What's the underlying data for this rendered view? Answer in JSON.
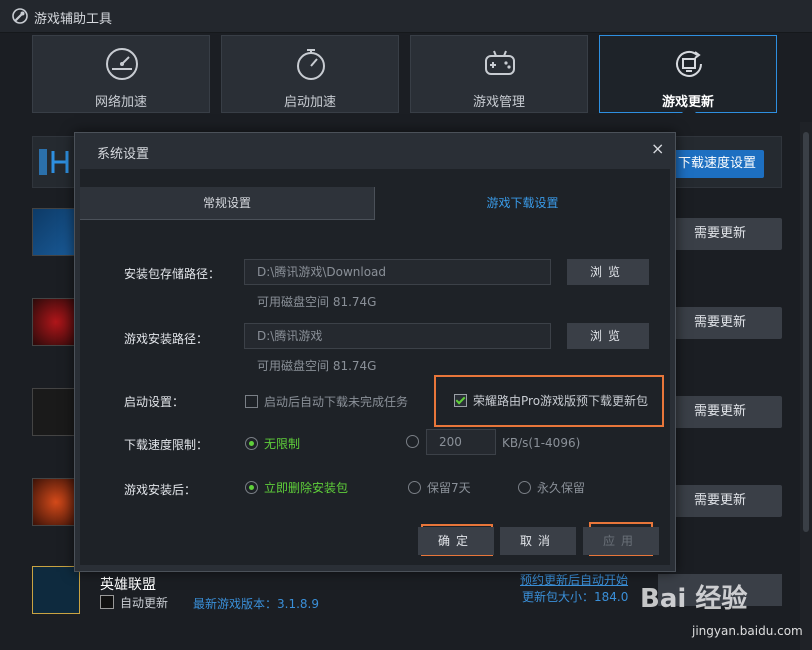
{
  "window": {
    "title": "游戏辅助工具"
  },
  "tabs": [
    {
      "label": "网络加速",
      "icon": "speedometer-icon"
    },
    {
      "label": "启动加速",
      "icon": "stopwatch-icon"
    },
    {
      "label": "游戏管理",
      "icon": "gamepad-icon"
    },
    {
      "label": "游戏更新",
      "icon": "monitor-refresh-icon",
      "active": true
    }
  ],
  "banner": {
    "speed_button": "下载速度设置"
  },
  "game_list": {
    "update_label": "需要更新",
    "lol": {
      "name": "英雄联盟",
      "auto_update": "自动更新",
      "version": "最新游戏版本：3.1.8.9",
      "link": "预约更新后自动开始",
      "size": "更新包大小：184.0"
    }
  },
  "dialog": {
    "title": "系统设置",
    "close": "×",
    "tabs": {
      "general": "常规设置",
      "download": "游戏下载设置"
    },
    "pkg_path_label": "安装包存储路径：",
    "pkg_path_value": "D:\\腾讯游戏\\Download",
    "browse": "浏览",
    "pkg_free": "可用磁盘空间 81.74G",
    "install_path_label": "游戏安装路径：",
    "install_path_value": "D:\\腾讯游戏",
    "install_free": "可用磁盘空间 81.74G",
    "startup_label": "启动设置：",
    "startup_option": "启动后自动下载未完成任务",
    "router_option": "荣耀路由Pro游戏版预下载更新包",
    "speed_label": "下载速度限制：",
    "speed_unlimited": "无限制",
    "speed_value": "200",
    "speed_unit": "KB/s(1-4096)",
    "after_install_label": "游戏安装后：",
    "after_opt1": "立即删除安装包",
    "after_opt2": "保留7天",
    "after_opt3": "永久保留",
    "ok": "确定",
    "cancel": "取消",
    "apply": "应用"
  },
  "watermark": {
    "brand": "Bai 经验",
    "url": "jingyan.baidu.com"
  },
  "colors": {
    "accent": "#2e8fe0",
    "highlight": "#e8763a",
    "check": "#5fcf3a"
  }
}
